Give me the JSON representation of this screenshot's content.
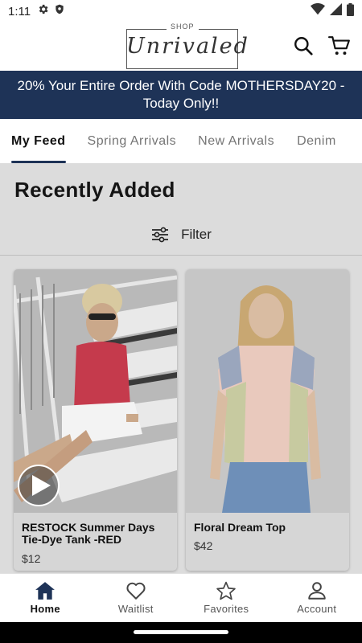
{
  "status_bar": {
    "time": "1:11"
  },
  "header": {
    "logo_small": "SHOP",
    "logo_script": "Unrivaled"
  },
  "promo": {
    "text": "20% Your Entire Order With Code MOTHERSDAY20 - Today Only!!"
  },
  "tabs": [
    {
      "label": "My Feed",
      "active": true
    },
    {
      "label": "Spring Arrivals",
      "active": false
    },
    {
      "label": "New Arrivals",
      "active": false
    },
    {
      "label": "Denim",
      "active": false
    }
  ],
  "feed": {
    "title": "Recently Added",
    "filter_label": "Filter"
  },
  "products": [
    {
      "name": "RESTOCK Summer Days Tie-Dye Tank -RED",
      "price": "$12",
      "has_video": true
    },
    {
      "name": "Floral Dream Top",
      "price": "$42",
      "has_video": false
    }
  ],
  "bottom_nav": [
    {
      "label": "Home",
      "icon": "home-icon",
      "active": true
    },
    {
      "label": "Waitlist",
      "icon": "heart-icon",
      "active": false
    },
    {
      "label": "Favorites",
      "icon": "star-icon",
      "active": false
    },
    {
      "label": "Account",
      "icon": "account-icon",
      "active": false
    }
  ],
  "colors": {
    "brand_navy": "#1e3357",
    "content_bg": "#dcdcdc"
  }
}
